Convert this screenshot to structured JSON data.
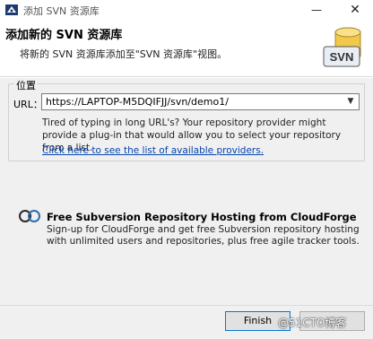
{
  "window": {
    "title": "添加 SVN 资源库",
    "minimize_glyph": "—",
    "close_glyph": "✕"
  },
  "banner": {
    "title": "添加新的 SVN 资源库",
    "description": "将新的 SVN 资源库添加至\"SVN 资源库\"视图。",
    "logo_text": "SVN"
  },
  "location": {
    "legend": "位置",
    "url_label": "URL：",
    "url_value": "https://LAPTOP-M5DQIFJJ/svn/demo1/",
    "hint": "Tired of typing in long URL's?  Your repository provider might provide a plug-in that would allow you to select your repository from a list.",
    "providers_link": "Click here to see the list of available providers."
  },
  "cloudforge": {
    "title": "Free Subversion Repository Hosting from CloudForge",
    "description": "Sign-up for CloudForge and get free Subversion repository hosting with unlimited users and repositories, plus free agile tracker tools."
  },
  "footer": {
    "finish_label": "Finish",
    "cancel_label": "",
    "watermark": "@51CTO博客"
  },
  "colors": {
    "link": "#0645ad",
    "focus_border": "#0078d7",
    "dialog_bg": "#f0f0f0"
  }
}
